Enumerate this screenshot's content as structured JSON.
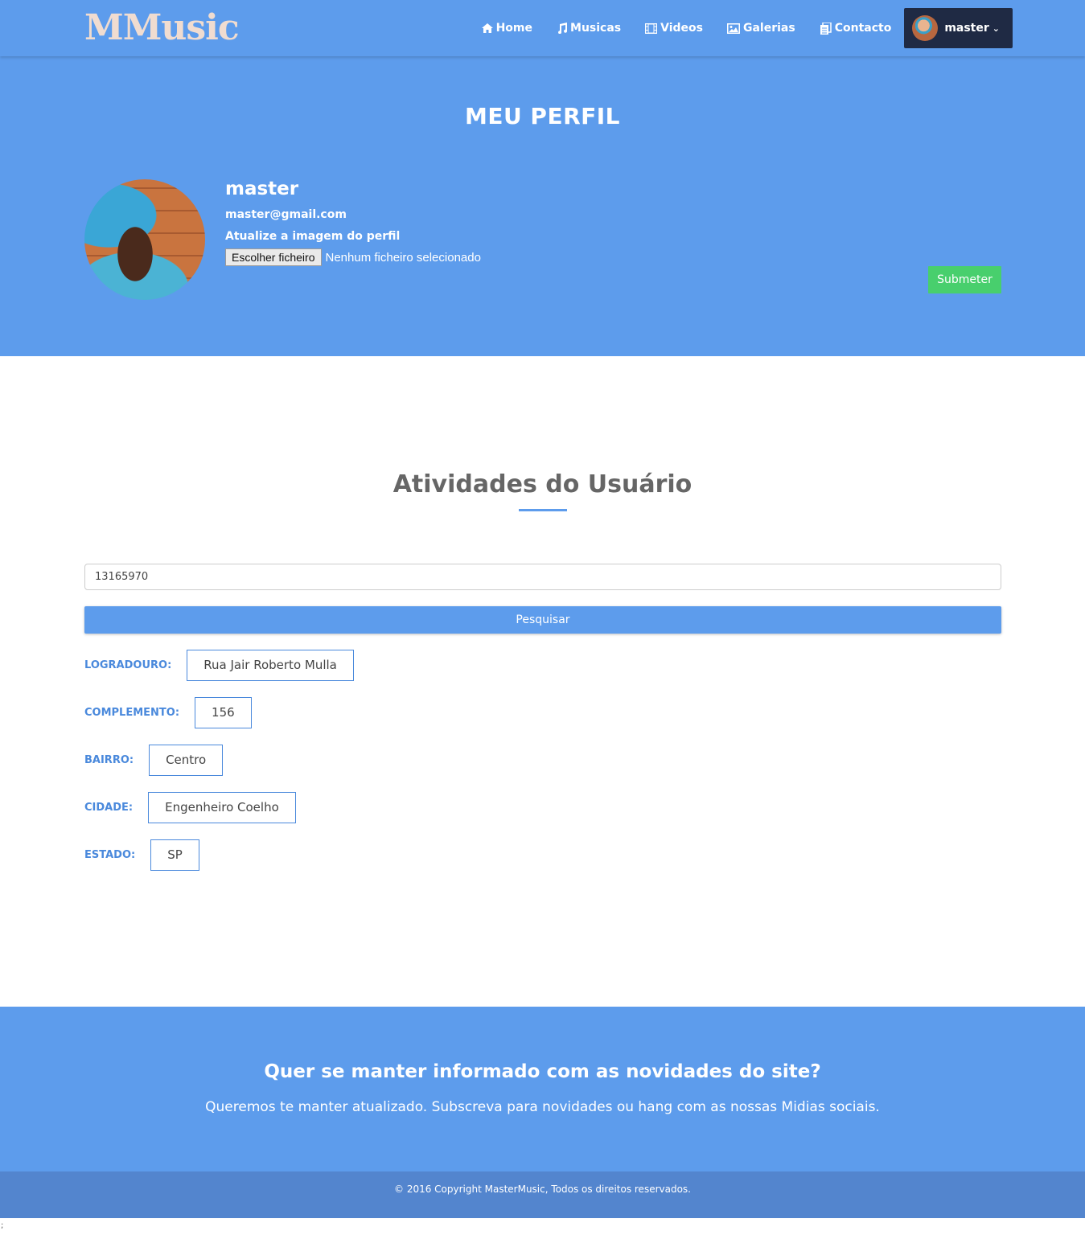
{
  "brand": {
    "logo": "MMusic"
  },
  "nav": {
    "items": [
      {
        "label": "Home",
        "icon": "home-icon"
      },
      {
        "label": "Musicas",
        "icon": "music-icon"
      },
      {
        "label": "Videos",
        "icon": "film-icon"
      },
      {
        "label": "Galerias",
        "icon": "picture-icon"
      },
      {
        "label": "Contacto",
        "icon": "document-icon"
      }
    ],
    "user": {
      "name": "master"
    }
  },
  "profile": {
    "title": "MEU PERFIL",
    "name": "master",
    "email": "master@gmail.com",
    "update_label": "Atualize a imagem do perfil",
    "file_button": "Escolher ficheiro",
    "file_status": "Nenhum ficheiro selecionado",
    "submit_label": "Submeter"
  },
  "activities": {
    "title": "Atividades do Usuário",
    "search_value": "13165970",
    "search_button": "Pesquisar",
    "fields": [
      {
        "label": "LOGRADOURO:",
        "value": "Rua Jair Roberto Mulla"
      },
      {
        "label": "COMPLEMENTO:",
        "value": "156"
      },
      {
        "label": "BAIRRO:",
        "value": "Centro"
      },
      {
        "label": "CIDADE:",
        "value": "Engenheiro Coelho"
      },
      {
        "label": "ESTADO:",
        "value": "SP"
      }
    ]
  },
  "footer": {
    "newsletter_title": "Quer se manter informado com as novidades do site?",
    "newsletter_text": "Queremos te manter atualizado. Subscreva para novidades ou hang com as nossas Midias sociais.",
    "copyright": "© 2016 Copyright MasterMusic,  Todos os direitos reservados."
  },
  "stray_text": ";",
  "colors": {
    "primary": "#5d9cec",
    "nav_user_bg": "#1f2a44",
    "submit_green": "#48cf6d",
    "footer_bottom": "#5385ce",
    "label_blue": "#4a89dc"
  }
}
